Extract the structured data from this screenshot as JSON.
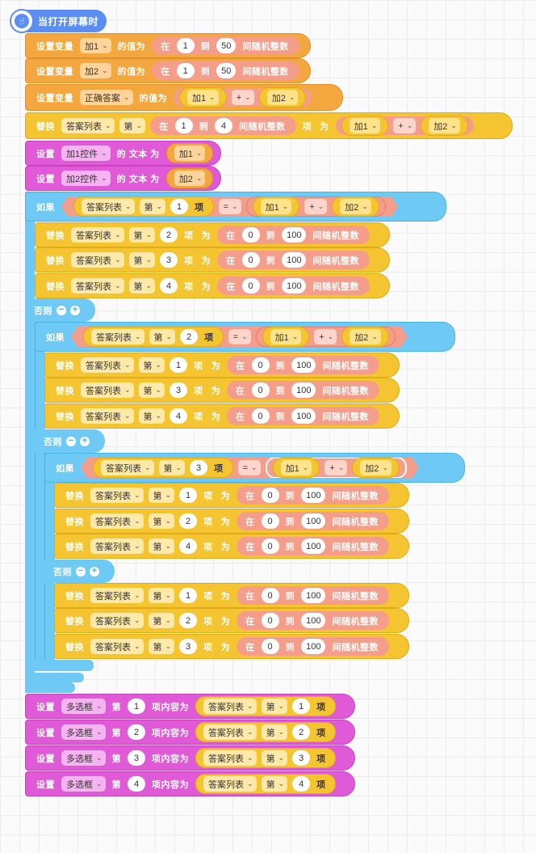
{
  "hat": {
    "label": "当打开屏幕时",
    "icon": "pointer-hand-icon"
  },
  "kw": {
    "set_var": "设置变量",
    "value_of": "的值为",
    "in": "在",
    "to": "到",
    "random_int": "间随机整数",
    "replace": "替换",
    "item": "项",
    "as": "为",
    "set": "设置",
    "text_as": "的 文本 为",
    "if": "如果",
    "else": "否则",
    "nth": "第",
    "item_content": "项内容为",
    "eq": "=",
    "plus": "+"
  },
  "vars": {
    "a": "加1",
    "b": "加2",
    "answer": "正确答案",
    "list": "答案列表",
    "multi": "多选框",
    "ctrl_a": "加1控件",
    "ctrl_b": "加2控件"
  },
  "nums": {
    "n0": "0",
    "n1": "1",
    "n2": "2",
    "n3": "3",
    "n4": "4",
    "n50": "50",
    "n100": "100"
  },
  "colors": {
    "orange": "#f4a63f",
    "yellow": "#f5c431",
    "pink": "#e05ad8",
    "blue": "#6ec9f5",
    "hat": "#5b8ef0",
    "salmon": "#f59d8b"
  }
}
